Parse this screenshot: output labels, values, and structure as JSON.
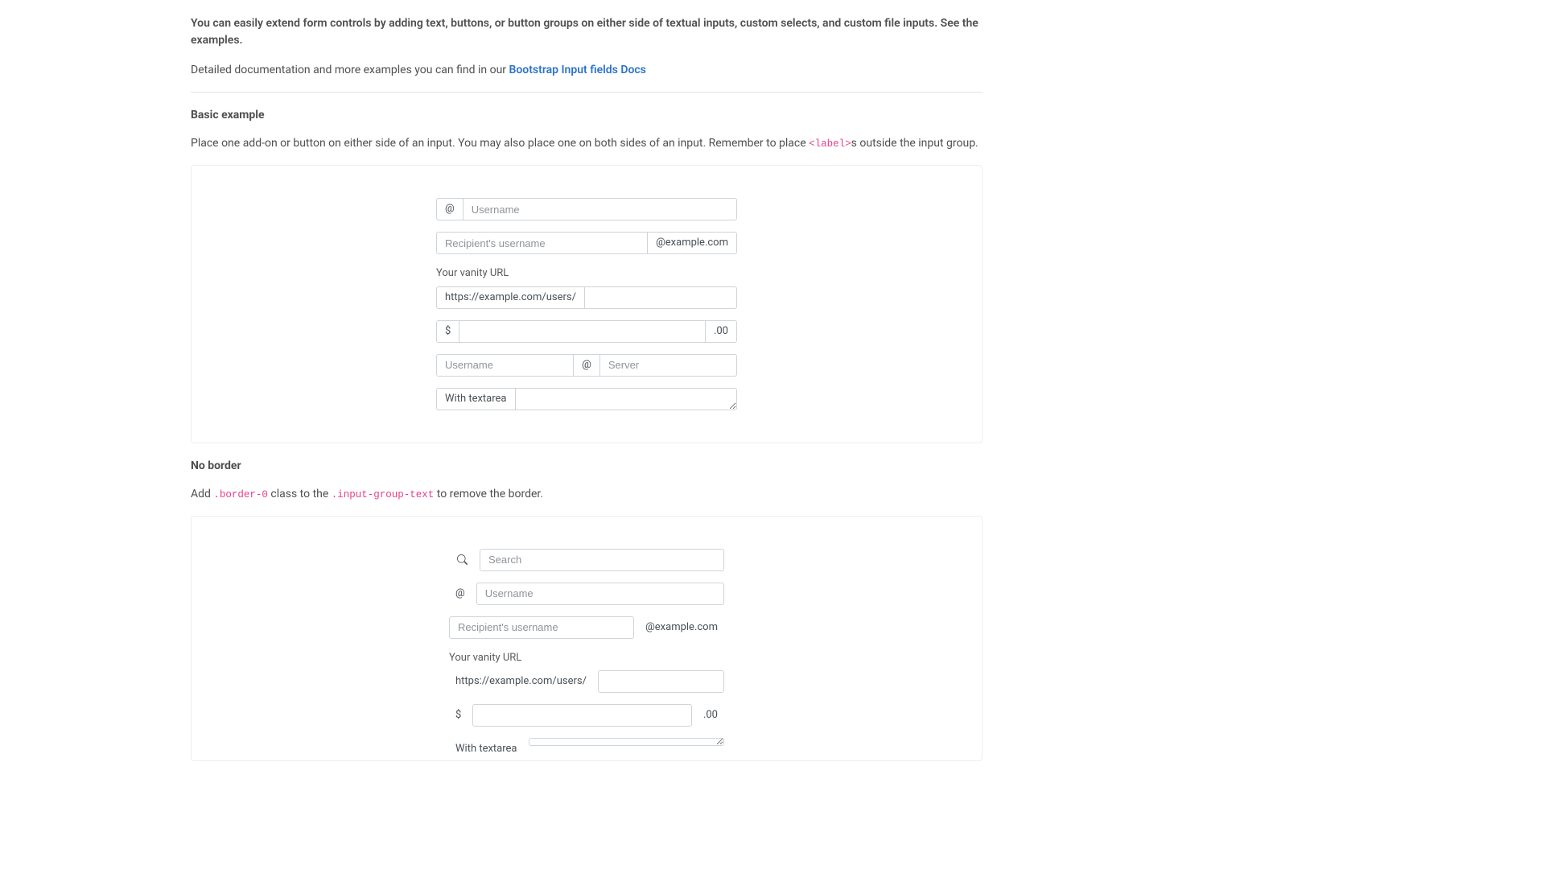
{
  "intro": {
    "lead": "You can easily extend form controls by adding text, buttons, or button groups on either side of textual inputs, custom selects, and custom file inputs. See the examples.",
    "detail_prefix": "Detailed documentation and more examples you can find in our ",
    "docs_link_text": "Bootstrap Input fields Docs"
  },
  "basic": {
    "title": "Basic example",
    "desc_prefix": "Place one add-on or button on either side of an input. You may also place one on both sides of an input. Remember to place ",
    "desc_code": "<label>",
    "desc_suffix": "s outside the input group.",
    "addon_at": "@",
    "username_placeholder": "Username",
    "recipient_placeholder": "Recipient's username",
    "addon_domain": "@example.com",
    "vanity_label": "Your vanity URL",
    "addon_url": "https://example.com/users/",
    "addon_dollar": "$",
    "addon_cents": ".00",
    "server_placeholder": "Server",
    "addon_textarea": "With textarea"
  },
  "noborder": {
    "title": "No border",
    "desc_p1": "Add ",
    "code1": ".border-0",
    "desc_p2": " class to the ",
    "code2": ".input-group-text",
    "desc_p3": " to remove the border.",
    "search_placeholder": "Search",
    "addon_at": "@",
    "username_placeholder": "Username",
    "recipient_placeholder": "Recipient's username",
    "addon_domain": "@example.com",
    "vanity_label": "Your vanity URL",
    "addon_url": "https://example.com/users/",
    "addon_dollar": "$",
    "addon_cents": ".00",
    "addon_textarea": "With textarea"
  }
}
